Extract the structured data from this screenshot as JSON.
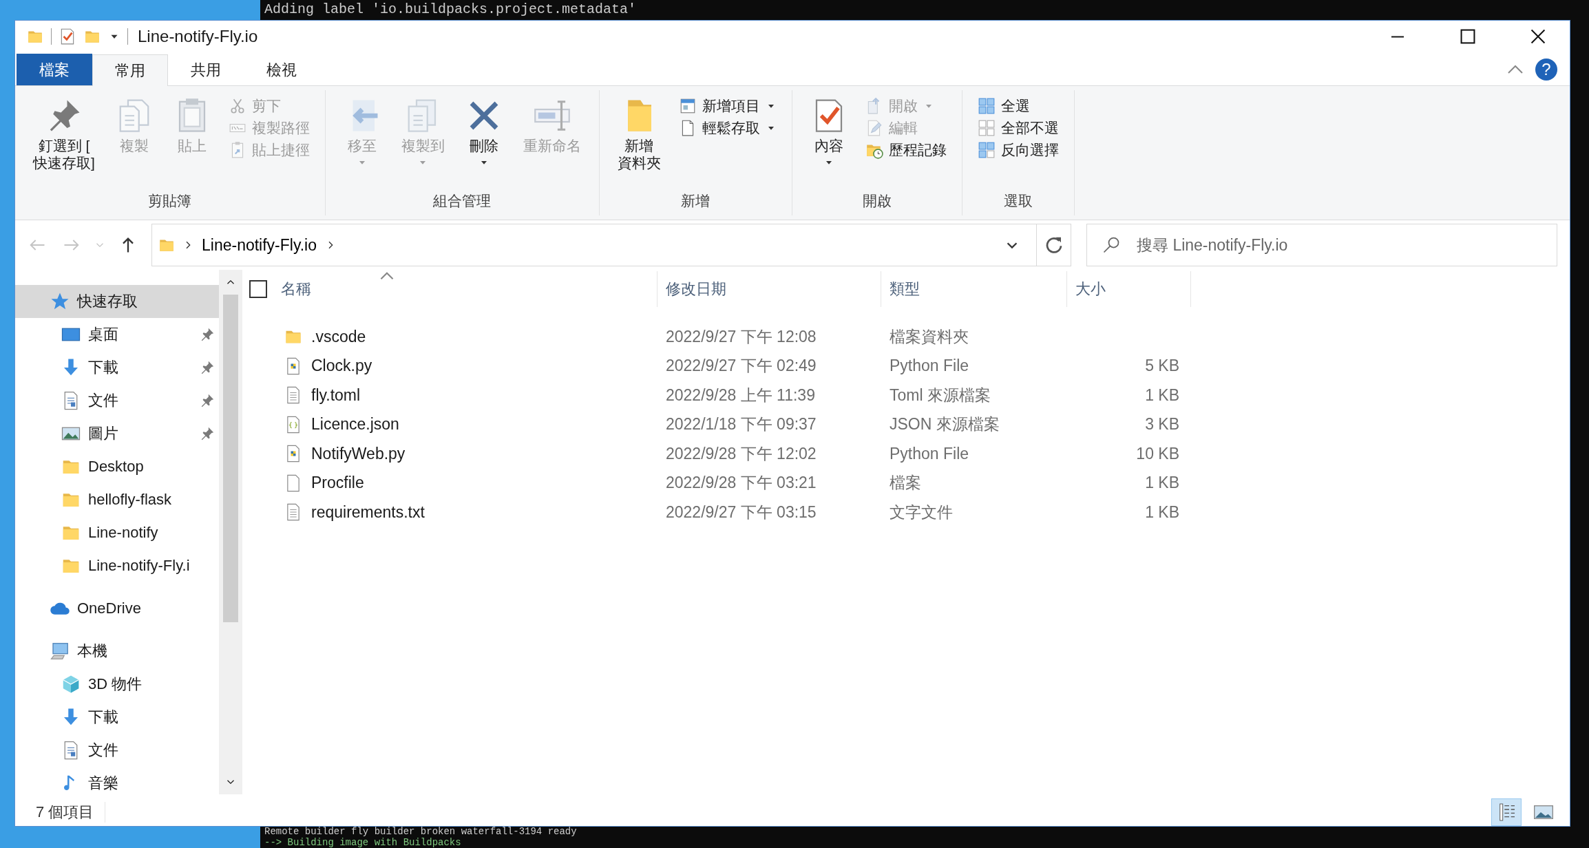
{
  "terminal": {
    "top_lines": [
      "Adding label 'io.buildpacks.project.metadata'"
    ],
    "bottom_lines": [
      "Remote builder fly builder broken waterfall-3194 ready",
      "--> Building image with Buildpacks"
    ]
  },
  "window": {
    "title": "Line-notify-Fly.io",
    "help_label": "?"
  },
  "ribbon_tabs": [
    {
      "label": "檔案",
      "kind": "file",
      "selected": false
    },
    {
      "label": "常用",
      "kind": "tab",
      "selected": true
    },
    {
      "label": "共用",
      "kind": "tab",
      "selected": false
    },
    {
      "label": "檢視",
      "kind": "tab",
      "selected": false
    }
  ],
  "ribbon_groups": [
    {
      "label": "剪貼簿",
      "large_items": [
        {
          "lines": [
            "釘選到 [",
            "快速存取]"
          ],
          "kind": "pin",
          "disabled": false,
          "has_menu": false
        },
        {
          "lines": [
            "複製"
          ],
          "kind": "copy",
          "disabled": true,
          "has_menu": false
        },
        {
          "lines": [
            "貼上"
          ],
          "kind": "paste",
          "disabled": true,
          "has_menu": false
        }
      ],
      "small_items": [
        {
          "label": "剪下",
          "kind": "cut",
          "disabled": true,
          "has_menu": false
        },
        {
          "label": "複製路徑",
          "kind": "copy-path",
          "disabled": true,
          "has_menu": false
        },
        {
          "label": "貼上捷徑",
          "kind": "paste-shortcut",
          "disabled": true,
          "has_menu": false
        }
      ]
    },
    {
      "label": "組合管理",
      "large_items": [
        {
          "lines": [
            "移至"
          ],
          "kind": "move",
          "disabled": true,
          "has_menu": true
        },
        {
          "lines": [
            "複製到"
          ],
          "kind": "copy-to",
          "disabled": true,
          "has_menu": true
        },
        {
          "lines": [
            "刪除"
          ],
          "kind": "delete",
          "disabled": false,
          "has_menu": true
        },
        {
          "lines": [
            "重新命名"
          ],
          "kind": "rename",
          "disabled": true,
          "has_menu": false
        }
      ]
    },
    {
      "label": "新增",
      "large_items": [
        {
          "lines": [
            "新增",
            "資料夾"
          ],
          "kind": "new-folder",
          "disabled": false,
          "has_menu": false
        }
      ],
      "small_items": [
        {
          "label": "新增項目",
          "kind": "new-item",
          "disabled": false,
          "has_menu": true
        },
        {
          "label": "輕鬆存取",
          "kind": "easy-access",
          "disabled": false,
          "has_menu": true
        }
      ]
    },
    {
      "label": "開啟",
      "large_items": [
        {
          "lines": [
            "內容"
          ],
          "kind": "properties",
          "disabled": false,
          "has_menu": true
        }
      ],
      "small_items": [
        {
          "label": "開啟",
          "kind": "open",
          "disabled": true,
          "has_menu": true
        },
        {
          "label": "編輯",
          "kind": "edit",
          "disabled": true,
          "has_menu": false
        },
        {
          "label": "歷程記錄",
          "kind": "history",
          "disabled": false,
          "has_menu": false
        }
      ]
    },
    {
      "label": "選取",
      "small_items": [
        {
          "label": "全選",
          "kind": "select-all",
          "disabled": false,
          "has_menu": false
        },
        {
          "label": "全部不選",
          "kind": "select-none",
          "disabled": false,
          "has_menu": false
        },
        {
          "label": "反向選擇",
          "kind": "invert",
          "disabled": false,
          "has_menu": false
        }
      ]
    }
  ],
  "nav_buttons": [
    {
      "kind": "back",
      "disabled": true
    },
    {
      "kind": "forward",
      "disabled": true
    },
    {
      "kind": "recent",
      "disabled": true
    },
    {
      "kind": "up",
      "disabled": false
    }
  ],
  "address": {
    "segments": [
      "Line-notify-Fly.io"
    ]
  },
  "search": {
    "placeholder": "搜尋 Line-notify-Fly.io"
  },
  "sidebar": {
    "items": [
      {
        "label": "快速存取",
        "kind": "quick",
        "selected": true,
        "pinned": false,
        "children": [
          {
            "label": "桌面",
            "kind": "desktop",
            "selected": false,
            "pinned": true
          },
          {
            "label": "下載",
            "kind": "download",
            "selected": false,
            "pinned": true
          },
          {
            "label": "文件",
            "kind": "document",
            "selected": false,
            "pinned": true
          },
          {
            "label": "圖片",
            "kind": "picture",
            "selected": false,
            "pinned": true
          },
          {
            "label": "Desktop",
            "kind": "folder",
            "selected": false,
            "pinned": false
          },
          {
            "label": "hellofly-flask",
            "kind": "folder",
            "selected": false,
            "pinned": false
          },
          {
            "label": "Line-notify",
            "kind": "folder",
            "selected": false,
            "pinned": false
          },
          {
            "label": "Line-notify-Fly.i",
            "kind": "folder",
            "selected": false,
            "pinned": false
          }
        ]
      },
      {
        "label": "OneDrive",
        "kind": "cloud",
        "selected": false,
        "pinned": false
      },
      {
        "label": "本機",
        "kind": "pc",
        "selected": false,
        "pinned": false,
        "children": [
          {
            "label": "3D 物件",
            "kind": "cube",
            "selected": false,
            "pinned": false
          },
          {
            "label": "下載",
            "kind": "download",
            "selected": false,
            "pinned": false
          },
          {
            "label": "文件",
            "kind": "document",
            "selected": false,
            "pinned": false
          },
          {
            "label": "音樂",
            "kind": "music",
            "selected": false,
            "pinned": false
          }
        ]
      }
    ]
  },
  "table": {
    "select_all_checked": false,
    "columns": [
      {
        "label": "名稱",
        "sorted": true
      },
      {
        "label": "修改日期",
        "sorted": false
      },
      {
        "label": "類型",
        "sorted": false
      },
      {
        "label": "大小",
        "sorted": false
      }
    ],
    "rows": [
      {
        "kind": "folder",
        "name": ".vscode",
        "modified": "2022/9/27 下午 12:08",
        "type": "檔案資料夾"
      },
      {
        "kind": "python",
        "name": "Clock.py",
        "modified": "2022/9/27 下午 02:49",
        "type": "Python File",
        "size": "5 KB"
      },
      {
        "kind": "text",
        "name": "fly.toml",
        "modified": "2022/9/28 上午 11:39",
        "type": "Toml 來源檔案",
        "size": "1 KB"
      },
      {
        "kind": "json",
        "name": "Licence.json",
        "modified": "2022/1/18 下午 09:37",
        "type": "JSON 來源檔案",
        "size": "3 KB"
      },
      {
        "kind": "python",
        "name": "NotifyWeb.py",
        "modified": "2022/9/28 下午 12:02",
        "type": "Python File",
        "size": "10 KB"
      },
      {
        "kind": "blank",
        "name": "Procfile",
        "modified": "2022/9/28 下午 03:21",
        "type": "檔案",
        "size": "1 KB"
      },
      {
        "kind": "text",
        "name": "requirements.txt",
        "modified": "2022/9/27 下午 03:15",
        "type": "文字文件",
        "size": "1 KB"
      }
    ]
  },
  "status_bar": {
    "item_count": "7 個項目",
    "views": [
      {
        "kind": "details",
        "selected": true
      },
      {
        "kind": "large-icons",
        "selected": false
      }
    ]
  }
}
